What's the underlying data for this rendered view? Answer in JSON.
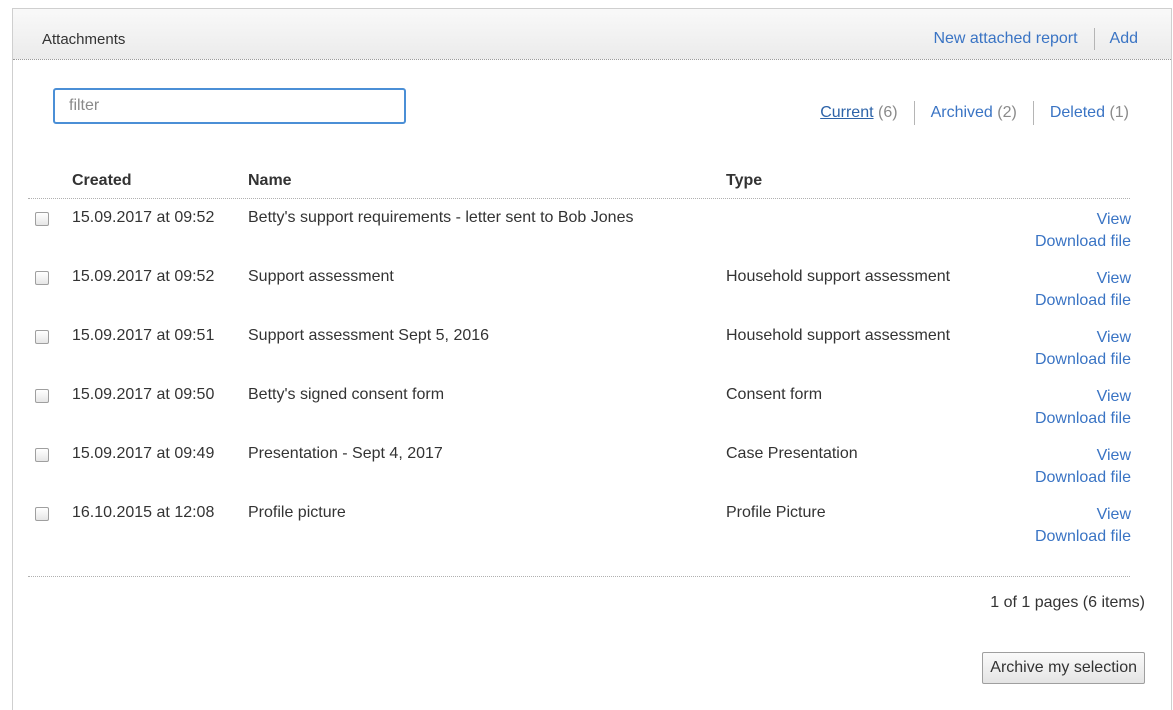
{
  "header": {
    "title": "Attachments",
    "new_report_label": "New attached report",
    "add_label": "Add"
  },
  "filter": {
    "placeholder": "filter",
    "value": ""
  },
  "tabs": [
    {
      "label": "Current",
      "count": "(6)",
      "active": true
    },
    {
      "label": "Archived",
      "count": "(2)",
      "active": false
    },
    {
      "label": "Deleted",
      "count": "(1)",
      "active": false
    }
  ],
  "table": {
    "columns": [
      "Created",
      "Name",
      "Type"
    ],
    "view_label": "View",
    "download_label": "Download file",
    "rows": [
      {
        "created": "15.09.2017 at 09:52",
        "name": "Betty's support requirements - letter sent to Bob Jones",
        "type": "",
        "checked": false
      },
      {
        "created": "15.09.2017 at 09:52",
        "name": "Support assessment",
        "type": "Household support assessment",
        "checked": false
      },
      {
        "created": "15.09.2017 at 09:51",
        "name": "Support assessment Sept 5, 2016",
        "type": "Household support assessment",
        "checked": false
      },
      {
        "created": "15.09.2017 at 09:50",
        "name": "Betty's signed consent form",
        "type": "Consent form",
        "checked": false
      },
      {
        "created": "15.09.2017 at 09:49",
        "name": "Presentation - Sept 4, 2017",
        "type": "Case Presentation",
        "checked": false
      },
      {
        "created": "16.10.2015 at 12:08",
        "name": "Profile picture",
        "type": "Profile Picture",
        "checked": false
      }
    ]
  },
  "pager": {
    "text": "1 of 1 pages (6 items)"
  },
  "archive_button_label": "Archive my selection",
  "colors": {
    "link": "#3a74c4",
    "focus_border": "#4b8fd6",
    "text": "#333333"
  }
}
